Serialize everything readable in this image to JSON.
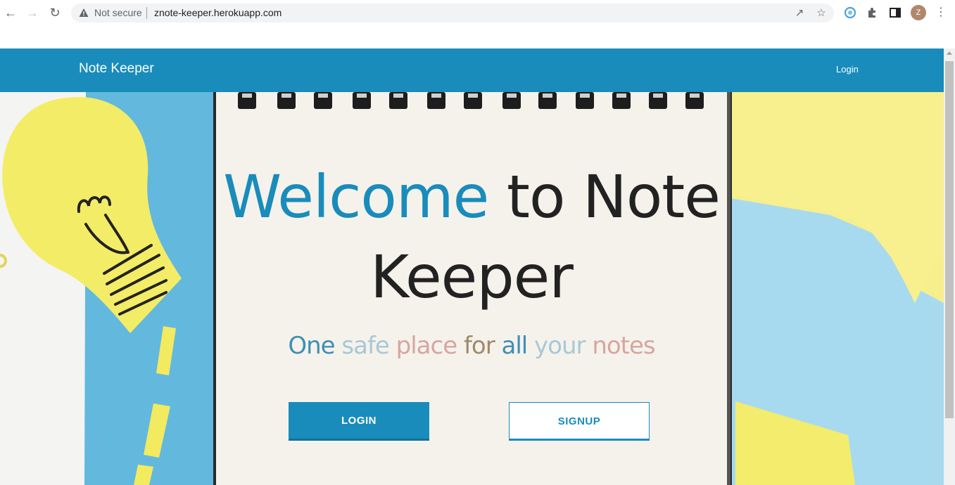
{
  "browser": {
    "security_label": "Not secure",
    "url": "znote-keeper.herokuapp.com",
    "profile_initial": "Z"
  },
  "navbar": {
    "brand": "Note Keeper",
    "login_link": "Login",
    "background_color": "#198cbb"
  },
  "hero": {
    "title_accent": "Welcome",
    "title_rest": " to Note Keeper",
    "tagline_words": [
      {
        "text": "One",
        "color": "#3f8fb2"
      },
      {
        "text": "safe",
        "color": "#a9c8d6"
      },
      {
        "text": "place",
        "color": "#d6a6a0"
      },
      {
        "text": "for",
        "color": "#a08a6a"
      },
      {
        "text": "all",
        "color": "#3f8fb2"
      },
      {
        "text": "your",
        "color": "#a9c8d6"
      },
      {
        "text": "notes",
        "color": "#d6a6a0"
      }
    ],
    "login_button": "LOGIN",
    "signup_button": "SIGNUP"
  },
  "colors": {
    "accent": "#198cbb",
    "sticky_yellow": "#f4ea6a",
    "paper_blue": "#63b8de",
    "notebook": "#f5f2ec"
  }
}
